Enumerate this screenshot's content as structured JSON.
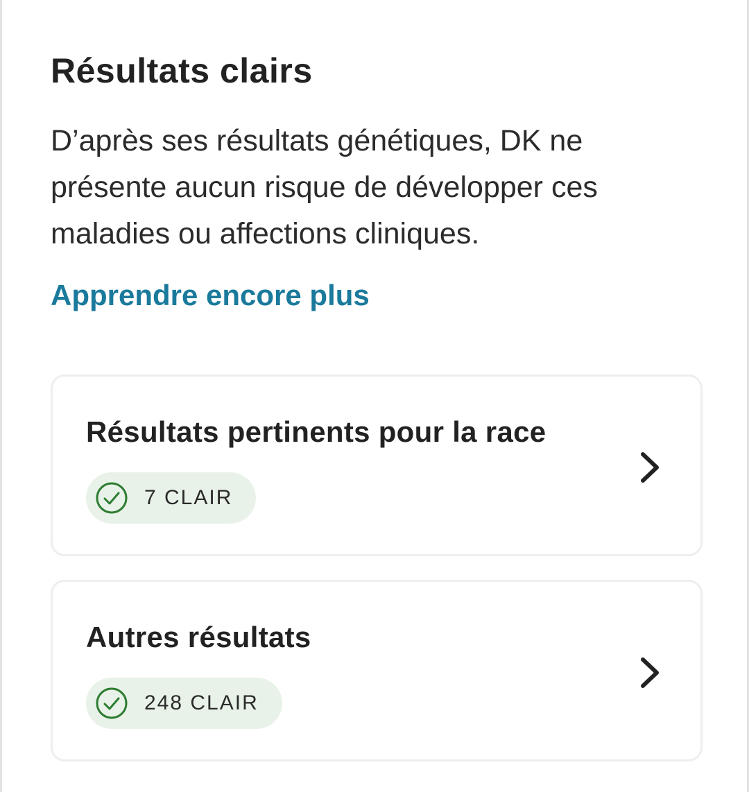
{
  "section": {
    "title": "Résultats clairs",
    "description": "D’après ses résultats génétiques, DK ne présente aucun risque de développer ces maladies ou affections cliniques.",
    "learn_more": "Apprendre encore plus"
  },
  "cards": [
    {
      "title": "Résultats pertinents pour la race",
      "badge": "7 CLAIR",
      "badge_icon": "check-circle-icon",
      "action_icon": "chevron-right-icon"
    },
    {
      "title": "Autres résultats",
      "badge": "248 CLAIR",
      "badge_icon": "check-circle-icon",
      "action_icon": "chevron-right-icon"
    }
  ],
  "colors": {
    "link": "#1a7a9c",
    "badge_background": "#e9f2e8",
    "check_green": "#2e7d32",
    "text": "#222222"
  }
}
